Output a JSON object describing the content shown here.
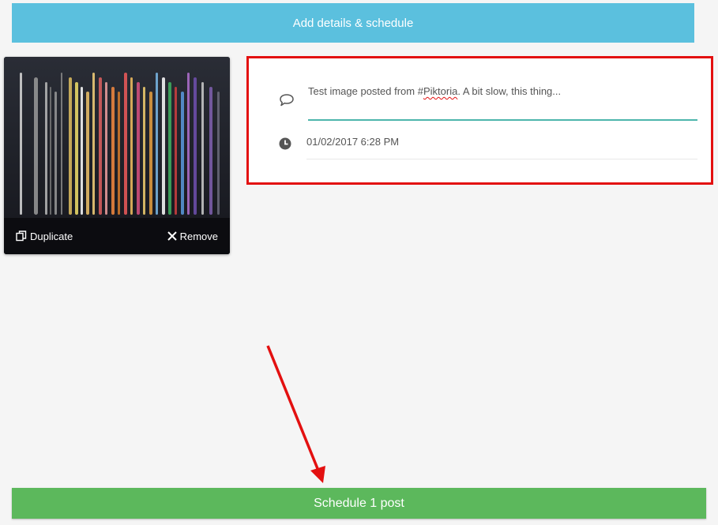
{
  "header": {
    "button_label": "Add details & schedule",
    "color": "#5bc0de"
  },
  "image_card": {
    "duplicate_label": "Duplicate",
    "remove_label": "Remove",
    "duplicate_icon": "copy-icon",
    "remove_icon": "close-icon"
  },
  "post": {
    "caption_prefix": "Test image posted from #",
    "caption_hashtag": "Piktoria",
    "caption_suffix": ". A bit slow, this thing...",
    "caption_icon": "comment-icon",
    "datetime": "01/02/2017 6:28 PM",
    "datetime_icon": "clock-icon"
  },
  "highlight_color": "#e31010",
  "footer": {
    "button_label": "Schedule 1 post",
    "color": "#5cb85c"
  }
}
